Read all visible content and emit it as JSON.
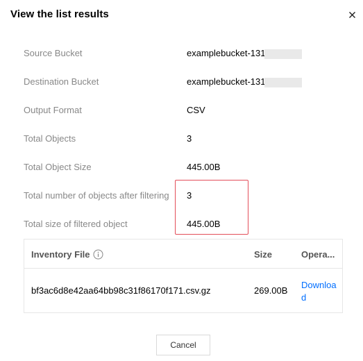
{
  "dialog": {
    "title": "View the list results"
  },
  "details": {
    "source_bucket": {
      "label": "Source Bucket",
      "value": "examplebucket-131"
    },
    "destination_bucket": {
      "label": "Destination Bucket",
      "value": "examplebucket-131"
    },
    "output_format": {
      "label": "Output Format",
      "value": "CSV"
    },
    "total_objects": {
      "label": "Total Objects",
      "value": "3"
    },
    "total_object_size": {
      "label": "Total Object Size",
      "value": "445.00B"
    },
    "filtered_count": {
      "label": "Total number of objects after filtering",
      "value": "3"
    },
    "filtered_size": {
      "label": "Total size of filtered object",
      "value": "445.00B"
    }
  },
  "table": {
    "headers": {
      "file": "Inventory File",
      "size": "Size",
      "operation": "Opera..."
    },
    "rows": [
      {
        "file": "bf3ac6d8e42aa64bb98c31f86170f171.csv.gz",
        "size": "269.00B",
        "action": "Download"
      }
    ]
  },
  "footer": {
    "cancel_label": "Cancel"
  },
  "colors": {
    "link": "#006eff",
    "highlight_border": "#e34d59"
  },
  "icons": {
    "close": "close-icon",
    "info": "info-icon"
  }
}
